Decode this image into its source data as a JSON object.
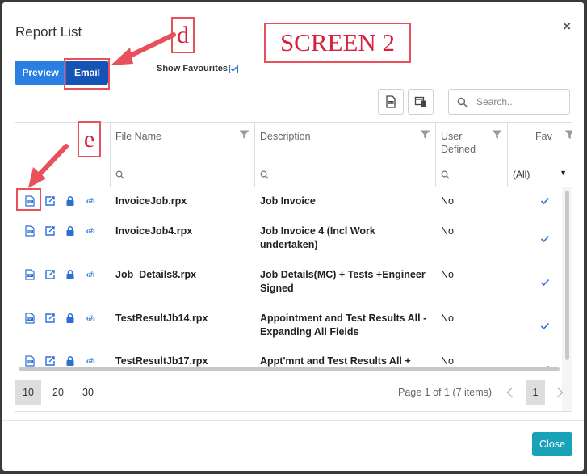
{
  "modal": {
    "title": "Report List",
    "close_symbol": "×"
  },
  "toolbar": {
    "preview_label": "Preview",
    "email_label": "Email",
    "show_favourites_label": "Show Favourites",
    "show_favourites_checked": true
  },
  "search": {
    "placeholder": "Search.."
  },
  "grid": {
    "columns": [
      {
        "key": "actions",
        "label": ""
      },
      {
        "key": "file_name",
        "label": "File Name"
      },
      {
        "key": "description",
        "label": "Description"
      },
      {
        "key": "user_defined",
        "label": "User Defined"
      },
      {
        "key": "fav",
        "label": "Fav"
      }
    ],
    "fav_filter_value": "(All)",
    "rows": [
      {
        "file_name": "InvoiceJob.rpx",
        "description": "Job Invoice",
        "user_defined": "No",
        "fav": true
      },
      {
        "file_name": "InvoiceJob4.rpx",
        "description": "Job Invoice 4 (Incl Work undertaken)",
        "user_defined": "No",
        "fav": true
      },
      {
        "file_name": "Job_Details8.rpx",
        "description": "Job Details(MC) + Tests +Engineer Signed",
        "user_defined": "No",
        "fav": true
      },
      {
        "file_name": "TestResultJb14.rpx",
        "description": "Appointment and Test Results All - Expanding All Fields",
        "user_defined": "No",
        "fav": true
      },
      {
        "file_name": "TestResultJb17.rpx",
        "description": "Appt'mnt and Test Results All +",
        "user_defined": "No",
        "fav": true
      }
    ],
    "row_action_tag": "‹#›"
  },
  "pager": {
    "sizes": [
      "10",
      "20",
      "30"
    ],
    "active_size": "10",
    "info": "Page 1 of 1 (7 items)",
    "current_page": "1"
  },
  "footer": {
    "close_label": "Close"
  },
  "annotations": {
    "letter_d": "d",
    "letter_e": "e",
    "screen_label": "SCREEN 2",
    "color": "#e8505b"
  },
  "colors": {
    "primary": "#2a7fe3",
    "primary_dark": "#1553b4",
    "info": "#17a2b8"
  }
}
